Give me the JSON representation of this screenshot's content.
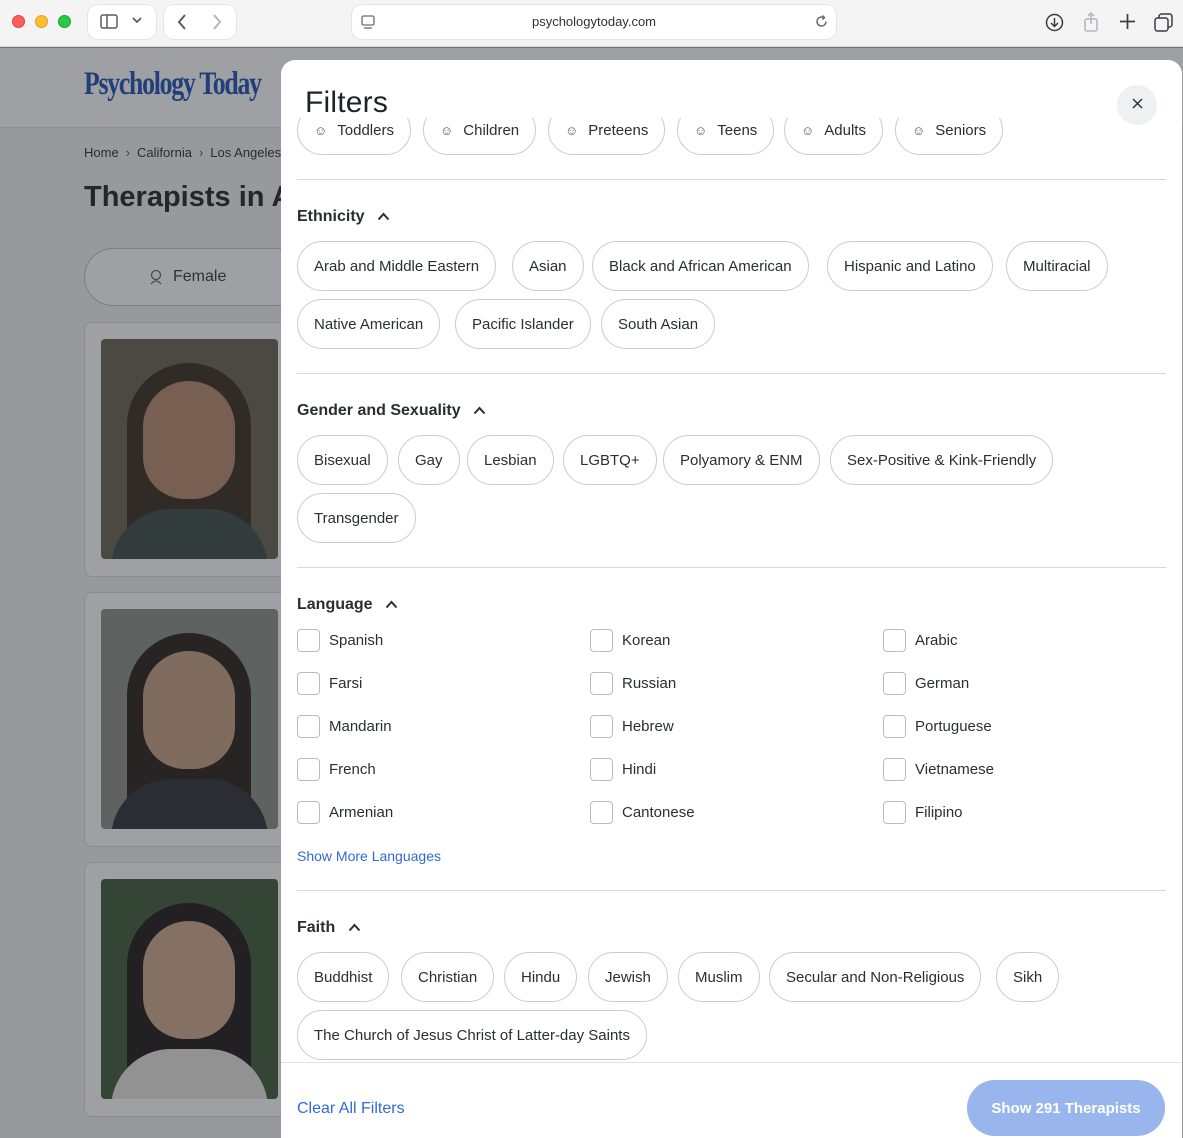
{
  "browser": {
    "url": "psychologytoday.com"
  },
  "background_page": {
    "logo": "Psychology Today",
    "breadcrumbs": [
      "Home",
      "California",
      "Los Angeles"
    ],
    "title": "Therapists in A",
    "gender_pill": "Female"
  },
  "modal": {
    "title": "Filters",
    "age_pills": [
      {
        "label": "Toddlers",
        "icon": "toddler-icon"
      },
      {
        "label": "Children",
        "icon": "child-icon"
      },
      {
        "label": "Preteens",
        "icon": "preteen-icon"
      },
      {
        "label": "Teens",
        "icon": "teen-icon"
      },
      {
        "label": "Adults",
        "icon": "adult-icon"
      },
      {
        "label": "Seniors",
        "icon": "senior-icon"
      }
    ],
    "ethnicity": {
      "heading": "Ethnicity",
      "options": [
        "Arab and Middle Eastern",
        "Asian",
        "Black and African American",
        "Hispanic and Latino",
        "Multiracial",
        "Native American",
        "Pacific Islander",
        "South Asian"
      ]
    },
    "gender_sexuality": {
      "heading": "Gender and Sexuality",
      "options": [
        "Bisexual",
        "Gay",
        "Lesbian",
        "LGBTQ+",
        "Polyamory & ENM",
        "Sex-Positive & Kink-Friendly",
        "Transgender"
      ]
    },
    "language": {
      "heading": "Language",
      "options": [
        "Spanish",
        "Korean",
        "Arabic",
        "Farsi",
        "Russian",
        "German",
        "Mandarin",
        "Hebrew",
        "Portuguese",
        "French",
        "Hindi",
        "Vietnamese",
        "Armenian",
        "Cantonese",
        "Filipino"
      ],
      "show_more": "Show More Languages"
    },
    "faith": {
      "heading": "Faith",
      "options": [
        "Buddhist",
        "Christian",
        "Hindu",
        "Jewish",
        "Muslim",
        "Secular and Non-Religious",
        "Sikh",
        "The Church of Jesus Christ of Latter-day Saints"
      ]
    },
    "footer": {
      "clear": "Clear All Filters",
      "show": "Show 291 Therapists"
    }
  },
  "colors": {
    "accent": "#2f6bd8",
    "show_button": "#98b5ee",
    "logo": "#1d4fb3"
  }
}
